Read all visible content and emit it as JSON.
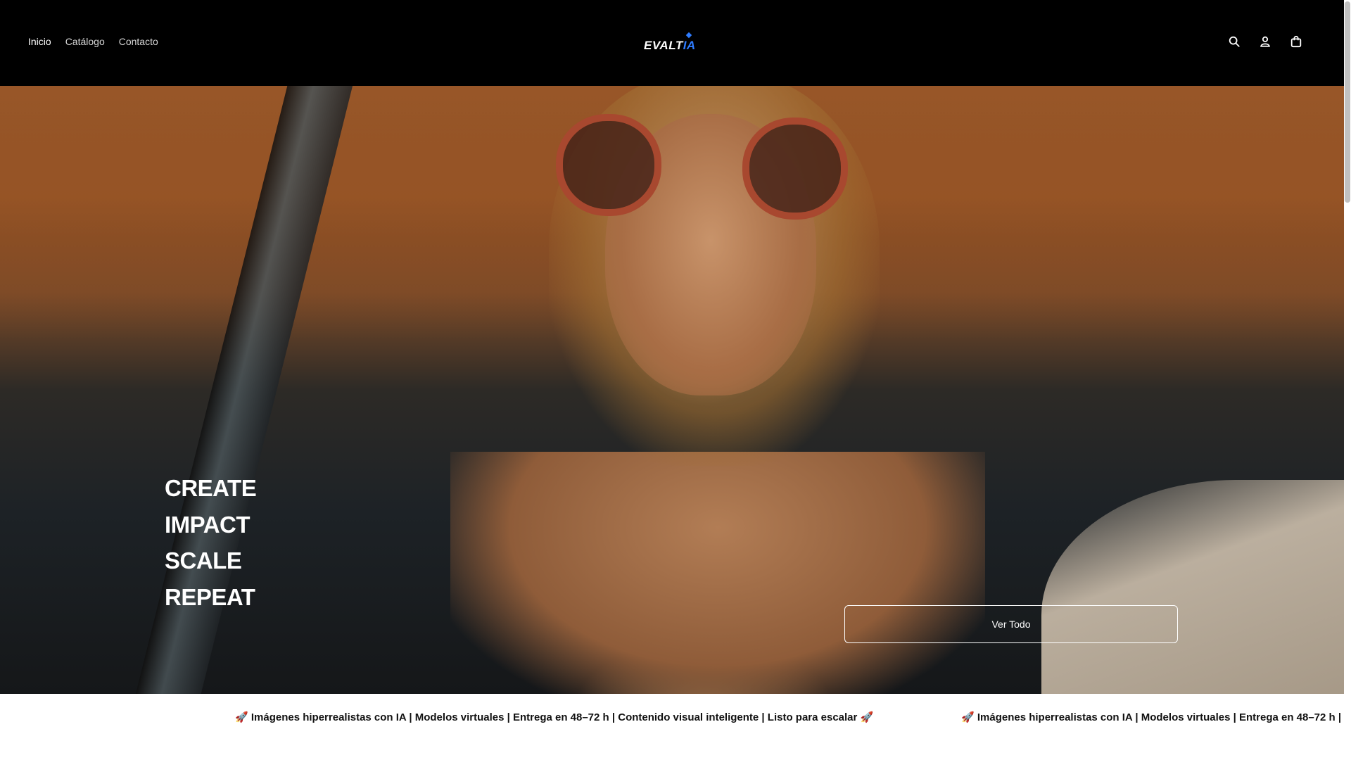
{
  "header": {
    "nav": [
      {
        "label": "Inicio",
        "active": true
      },
      {
        "label": "Catálogo",
        "active": false
      },
      {
        "label": "Contacto",
        "active": false
      }
    ],
    "logo": {
      "main": "EVALT",
      "accent": "IA"
    },
    "icons": [
      "search-icon",
      "account-icon",
      "cart-icon"
    ]
  },
  "hero": {
    "headline": [
      "CREATE",
      "IMPACT",
      "SCALE",
      "REPEAT"
    ],
    "cta_label": "Ver Todo"
  },
  "marquee": {
    "text": "🚀 Imágenes hiperrealistas con IA | Modelos virtuales | Entrega en 48–72 h | Contenido visual inteligente | Listo para escalar 🚀"
  },
  "colors": {
    "header_bg": "#000000",
    "brand_accent": "#2f7cff",
    "marquee_bg": "#ffffff",
    "text_dark": "#111111"
  }
}
